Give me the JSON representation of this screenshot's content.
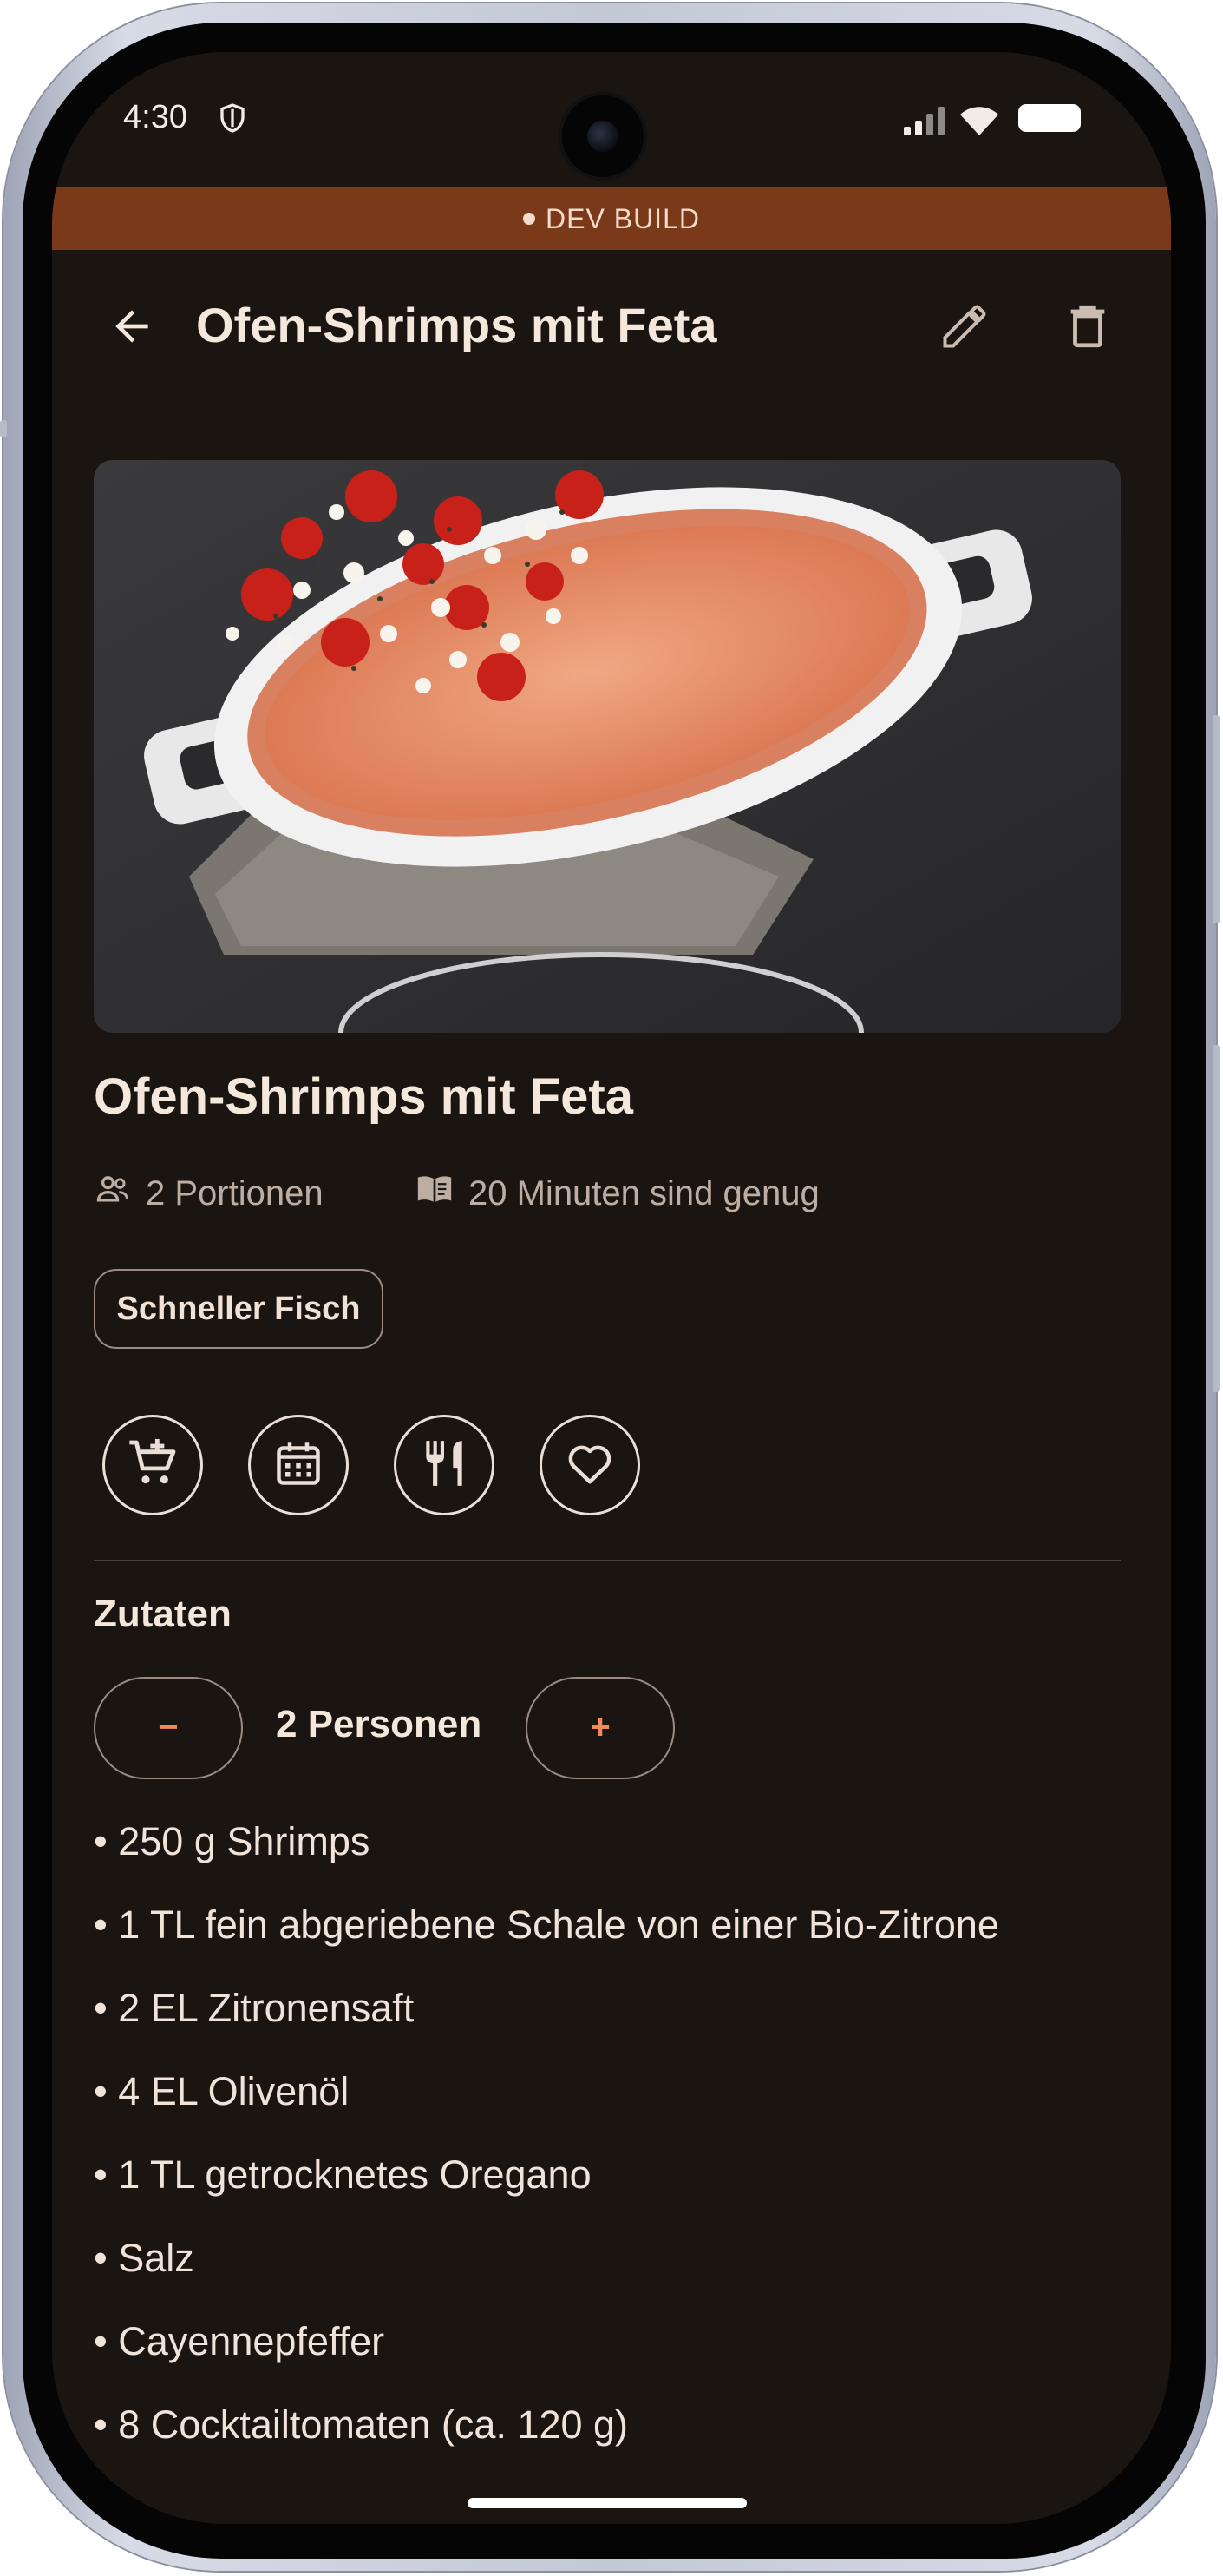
{
  "status_bar": {
    "time": "4:30"
  },
  "dev_banner": {
    "label": "DEV BUILD"
  },
  "app_bar": {
    "title": "Ofen-Shrimps mit Feta"
  },
  "recipe": {
    "title": "Ofen-Shrimps mit Feta",
    "servings": "2 Portionen",
    "duration": "20 Minuten sind genug",
    "category_chip": "Schneller Fisch"
  },
  "actions": [
    "cart-add-icon",
    "calendar-icon",
    "restaurant-icon",
    "heart-icon"
  ],
  "ingredients": {
    "heading": "Zutaten",
    "minus_label": "−",
    "plus_label": "+",
    "persons_label": "2 Personen",
    "items": [
      "• 250 g Shrimps",
      "• 1 TL fein abgeriebene Schale von einer Bio-Zitrone",
      "• 2 EL Zitronensaft",
      "• 4 EL Olivenöl",
      "• 1 TL getrocknetes Oregano",
      "• Salz",
      "• Cayennepfeffer",
      "• 8 Cocktailtomaten (ca. 120 g)"
    ]
  },
  "colors": {
    "background": "#1b1512",
    "dev_banner": "#7a3a1a",
    "accent": "#f08a5a",
    "text": "#f4e7dc",
    "muted_text": "#bcaea3"
  }
}
